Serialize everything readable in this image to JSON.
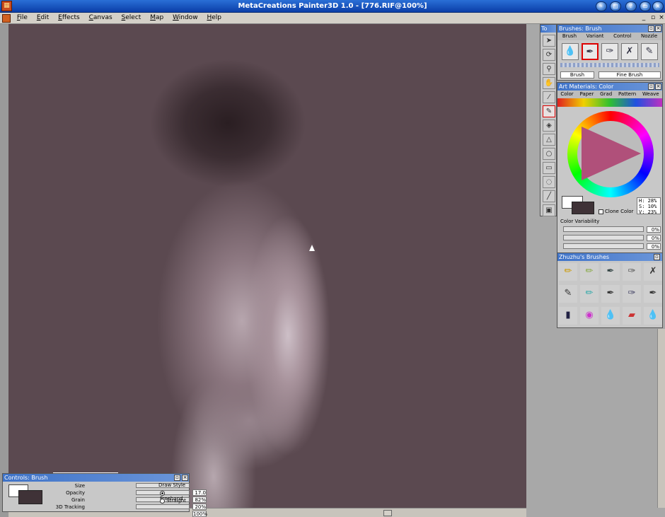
{
  "window": {
    "title": "MetaCreations Painter3D 1.0 - [776.RIF@100%]"
  },
  "menu": [
    "File",
    "Edit",
    "Effects",
    "Canvas",
    "Select",
    "Map",
    "Window",
    "Help"
  ],
  "toolbox": {
    "title": "To",
    "tools": [
      "arrow-icon",
      "rotate-icon",
      "magnifier-icon",
      "grabber-icon",
      "dropper-icon",
      "brush-icon",
      "paint-bucket-icon",
      "triangle-icon",
      "bulb-icon",
      "rect-select-icon",
      "lasso-icon",
      "line-icon",
      "stamp-icon"
    ]
  },
  "brushes_panel": {
    "title": "Brushes: Brush",
    "tabs": [
      "Brush",
      "Variant",
      "Control",
      "Nozzle"
    ],
    "icons": [
      "water-drop-icon",
      "brush-icon",
      "pen-icon",
      "crossed-pens-icon",
      "pen-nib-icon"
    ],
    "brush_label": "Brush",
    "variant_label": "Fine Brush"
  },
  "art_panel": {
    "title": "Art Materials: Color",
    "tabs": [
      "Color",
      "Paper",
      "Grad",
      "Pattern",
      "Weave"
    ],
    "hsv": {
      "h": "H:   28%",
      "s": "S:   10%",
      "v": "V:   23%"
    },
    "clone_color": "Clone Color",
    "variability_label": "Color Variability",
    "variability": [
      "0%",
      "0%",
      "0%"
    ],
    "primary_color": "#ffffff",
    "secondary_color": "#3f3237"
  },
  "zhu_panel": {
    "title": "Zhuzhu's Brushes",
    "icons": [
      "pencil-icon",
      "marker-icon",
      "pen-icon",
      "fine-pen-icon",
      "crossed-pens-icon",
      "brush-icon",
      "felt-pen-icon",
      "pen-icon",
      "pen-nib-icon",
      "pen-icon",
      "ink-bottle-icon",
      "color-swatch-icon",
      "water-drop-icon",
      "eraser-icon",
      "water-drop-icon"
    ]
  },
  "controls": {
    "title": "Controls: Brush",
    "rows": [
      {
        "label": "Size",
        "value": "17.0"
      },
      {
        "label": "Opacity",
        "value": "82%"
      },
      {
        "label": "Grain",
        "value": "20%"
      },
      {
        "label": "3D Tracking",
        "value": "100%"
      }
    ],
    "draw_style": {
      "label": "Draw Style",
      "freehand": "Freehand",
      "straight": "Straight"
    }
  }
}
